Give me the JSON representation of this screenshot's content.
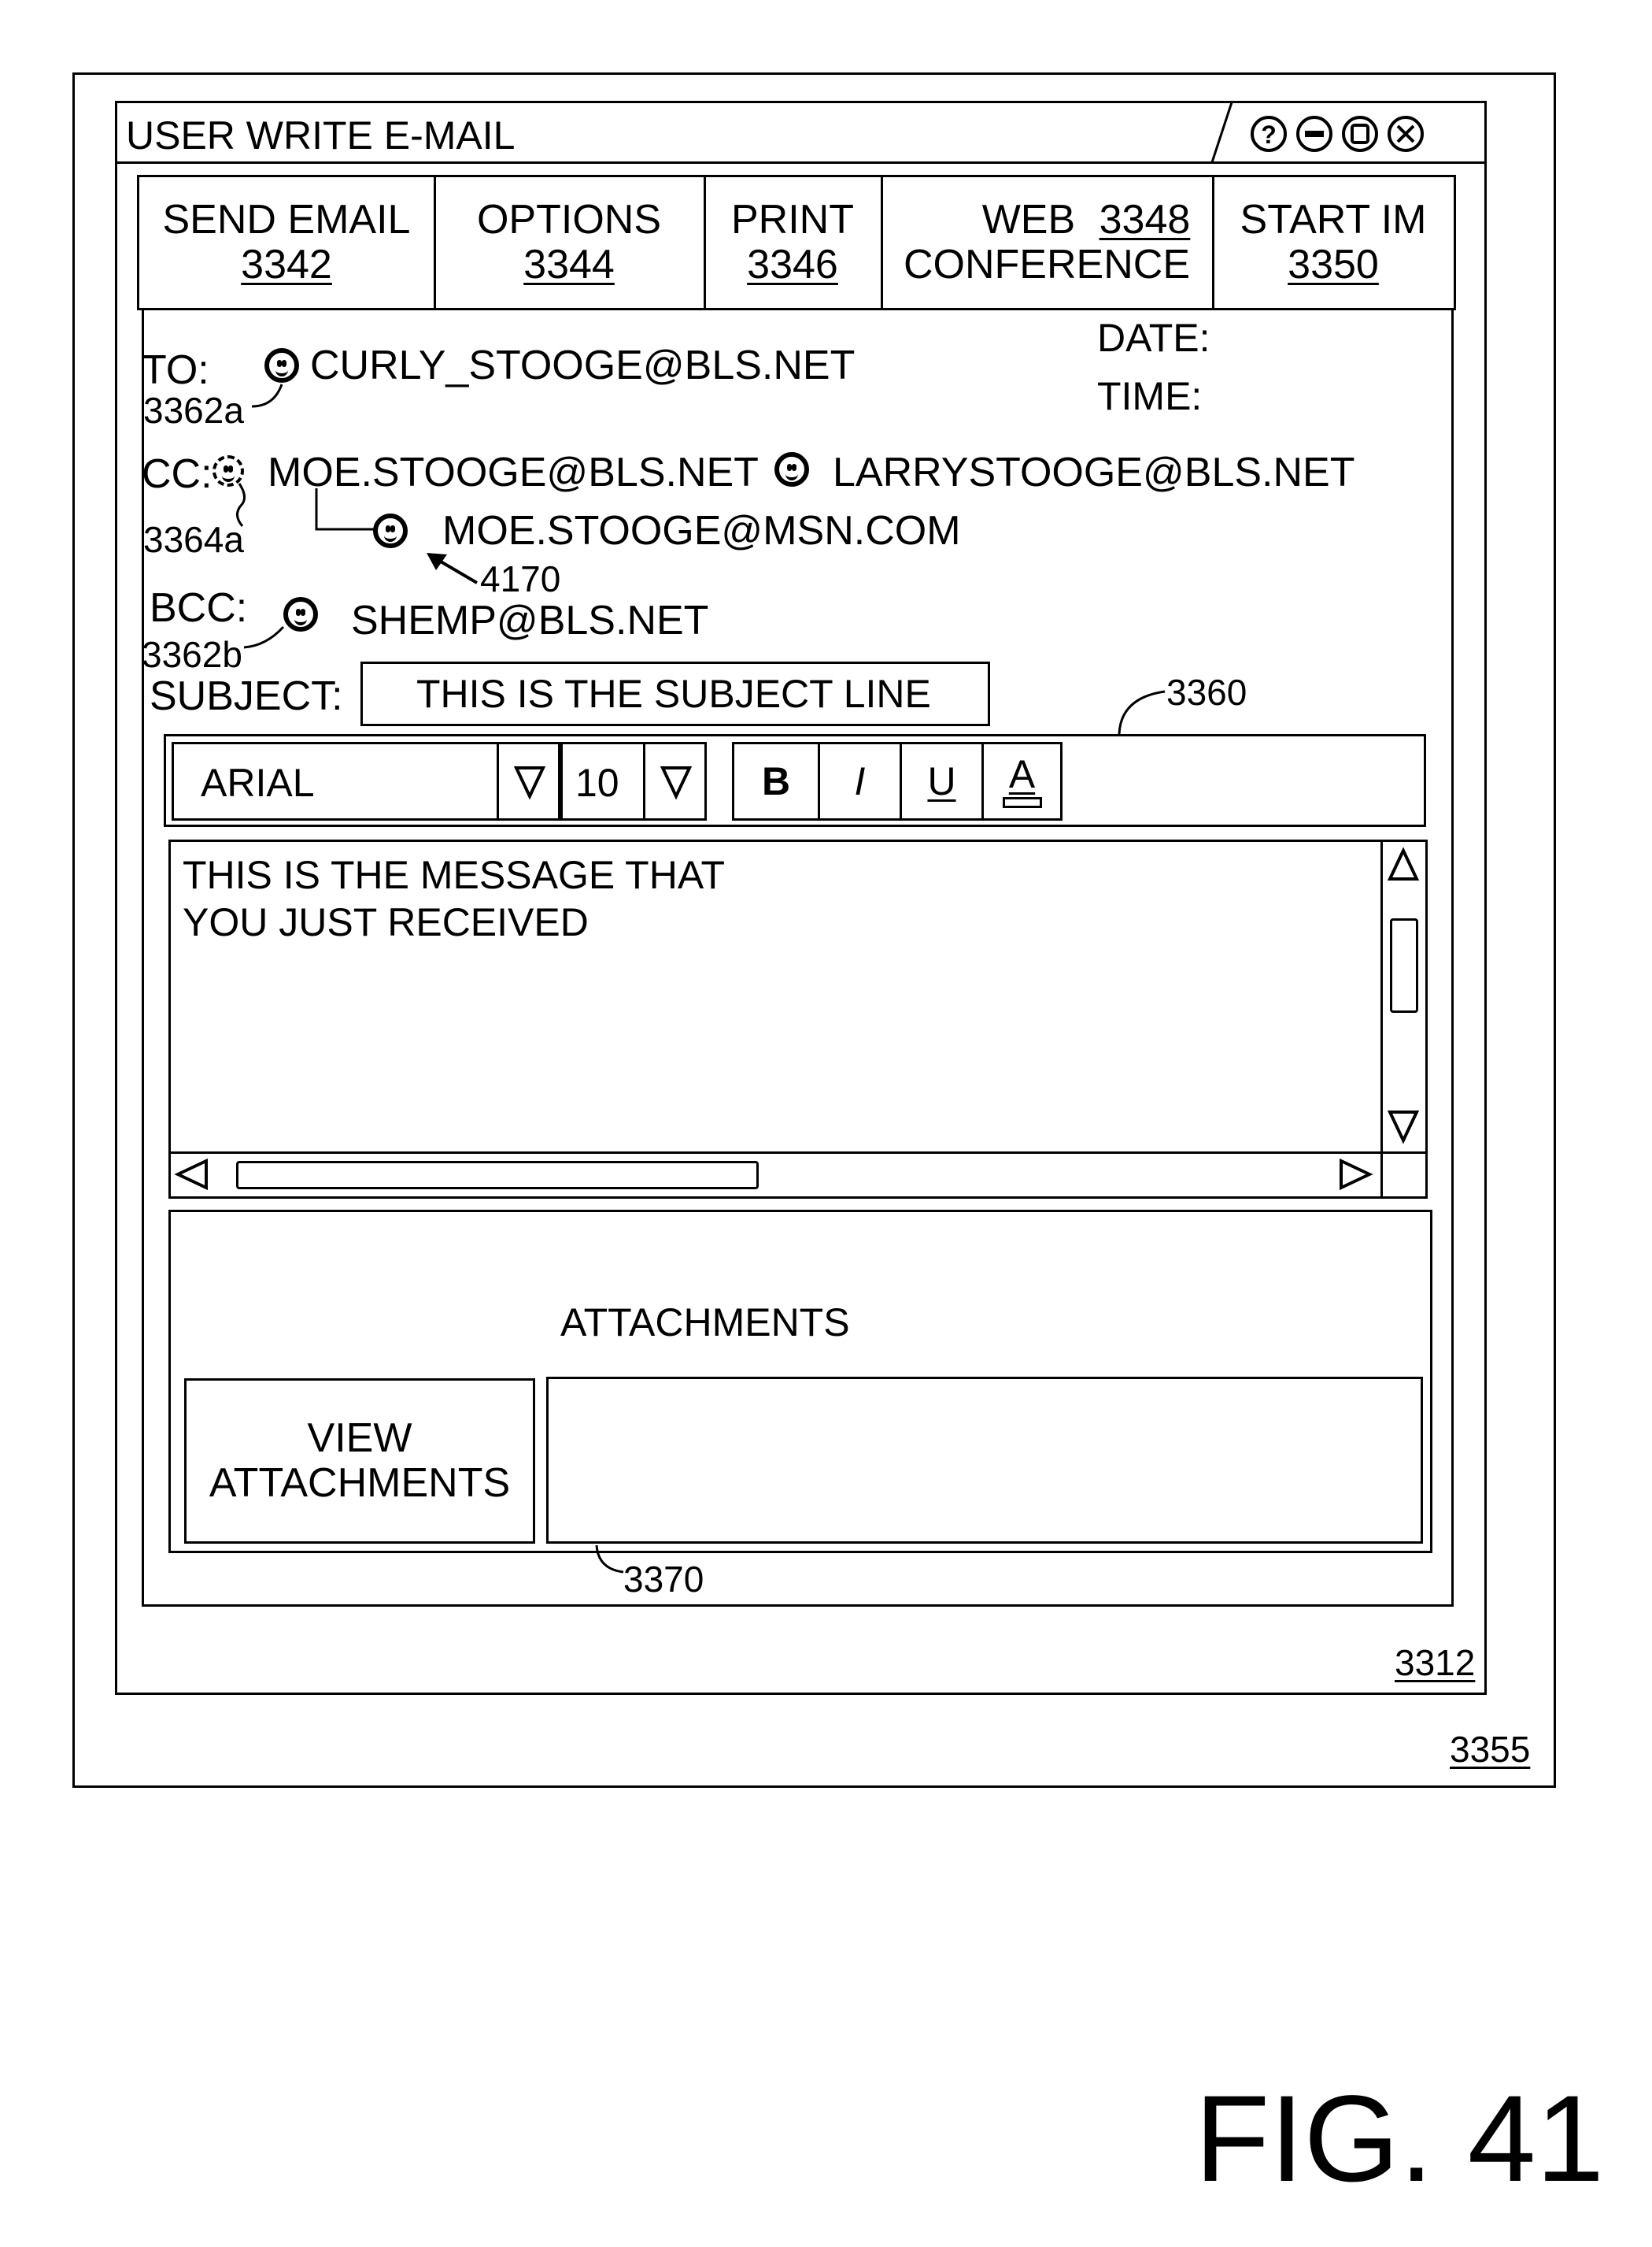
{
  "window": {
    "title": "USER WRITE E-MAIL",
    "controls": [
      "help-icon",
      "minimize-icon",
      "maximize-icon",
      "close-icon"
    ],
    "inner_ref": "3312",
    "outer_ref": "3355"
  },
  "toolbar": {
    "send": {
      "label": "SEND EMAIL",
      "ref": "3342"
    },
    "options": {
      "label": "OPTIONS",
      "ref": "3344"
    },
    "print": {
      "label": "PRINT",
      "ref": "3346"
    },
    "web": {
      "line1": "WEB",
      "ref": "3348",
      "line2": "CONFERENCE"
    },
    "im": {
      "label": "START IM",
      "ref": "3350"
    }
  },
  "header": {
    "to_label": "TO:",
    "to_address": "CURLY_STOOGE@BLS.NET",
    "to_ref": "3362a",
    "date_label": "DATE:",
    "time_label": "TIME:",
    "cc_label": "CC:",
    "cc_address_1": "MOE.STOOGE@BLS.NET",
    "cc_address_2": "LARRYSTOOGE@BLS.NET",
    "cc_ref": "3364a",
    "cc_alt_address": "MOE.STOOGE@MSN.COM",
    "cc_alt_ref": "4170",
    "bcc_label": "BCC:",
    "bcc_address": "SHEMP@BLS.NET",
    "bcc_ref": "3362b",
    "subject_label": "SUBJECT:",
    "subject_value": "THIS IS THE SUBJECT LINE"
  },
  "format_bar": {
    "ref": "3360",
    "font": "ARIAL",
    "size": "10",
    "bold": "B",
    "italic": "I",
    "underline": "U",
    "color": "A"
  },
  "message": {
    "line1": "THIS IS THE MESSAGE THAT",
    "line2": "YOU JUST RECEIVED"
  },
  "attachments": {
    "title": "ATTACHMENTS",
    "view_line1": "VIEW",
    "view_line2": "ATTACHMENTS",
    "ref": "3370"
  },
  "figure_label": "FIG. 41"
}
